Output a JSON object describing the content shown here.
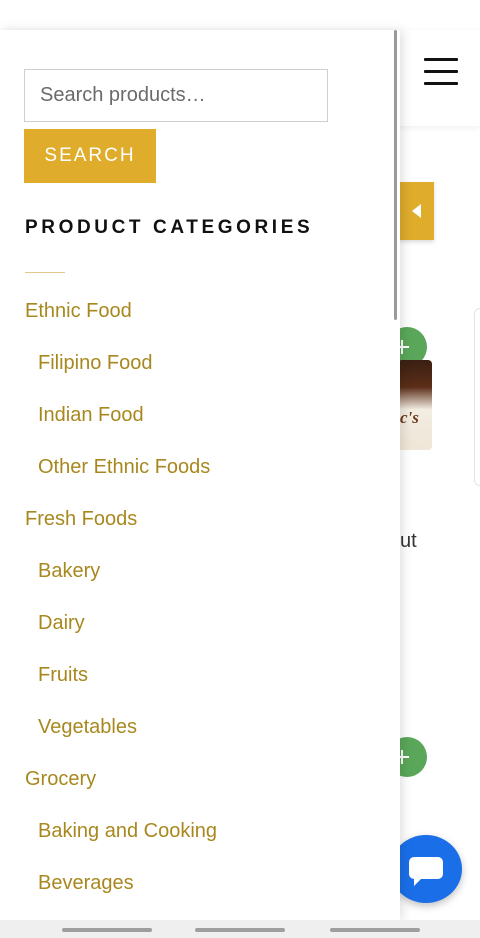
{
  "drawer": {
    "search": {
      "placeholder": "Search products…",
      "value": ""
    },
    "search_button_label": "SEARCH",
    "categories_heading": "PRODUCT CATEGORIES",
    "categories": [
      {
        "label": "Ethnic Food",
        "level": 0
      },
      {
        "label": "Filipino Food",
        "level": 1
      },
      {
        "label": "Indian Food",
        "level": 1
      },
      {
        "label": "Other Ethnic Foods",
        "level": 1
      },
      {
        "label": "Fresh Foods",
        "level": 0
      },
      {
        "label": "Bakery",
        "level": 1
      },
      {
        "label": "Dairy",
        "level": 1
      },
      {
        "label": "Fruits",
        "level": 1
      },
      {
        "label": "Vegetables",
        "level": 1
      },
      {
        "label": "Grocery",
        "level": 0
      },
      {
        "label": "Baking and Cooking",
        "level": 1
      },
      {
        "label": "Beverages",
        "level": 1
      }
    ]
  },
  "background": {
    "partial_text": "ut",
    "product_image_partial_text": "c's"
  },
  "icons": {
    "menu": "hamburger-menu-icon",
    "drawer_toggle": "chevron-left-icon",
    "add_to_cart": "plus-icon",
    "chat": "chat-bubble-icon"
  },
  "colors": {
    "accent": "#dfac2c",
    "category_link": "#a8881e",
    "add_button": "#5aa75a",
    "chat_button": "#1a6fe8"
  }
}
